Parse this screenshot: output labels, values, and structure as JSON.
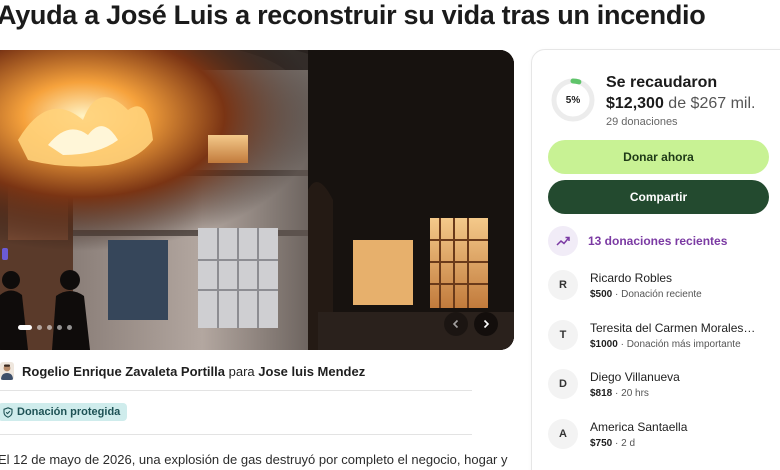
{
  "campaign": {
    "title": "Ayuda a José Luis a reconstruir su vida tras un incendio"
  },
  "gallery": {
    "slide_count": 5,
    "active_slide": 1,
    "prev_icon": "chevron-left-icon",
    "next_icon": "chevron-right-icon"
  },
  "organizer": {
    "name": "Rogelio Enrique Zavaleta Portilla",
    "connector": "para",
    "beneficiary": "Jose luis Mendez"
  },
  "badge": {
    "icon": "shield-icon",
    "label": "Donación protegida"
  },
  "story": {
    "excerpt": "El 12 de mayo de 2026, una explosión de gas destruyó por completo el negocio, hogar y"
  },
  "donation_card": {
    "progress_percent": 5,
    "progress_label": "5%",
    "raised_label": "Se recaudaron",
    "raised_amount": "$12,300",
    "goal_text": "de $267 mil.",
    "donation_count": "29 donaciones",
    "donate_label": "Donar ahora",
    "share_label": "Compartir",
    "recent_label": "13 donaciones recientes",
    "colors": {
      "progress": "#5fc46a",
      "donate_button": "#c8f294",
      "share_button": "#234a2f",
      "accent_purple": "#7b3aa3",
      "badge_bg": "#cfecec"
    },
    "donors": [
      {
        "initial": "R",
        "name": "Ricardo Robles",
        "amount": "$500",
        "note": "· Donación reciente"
      },
      {
        "initial": "T",
        "name": "Teresita del Carmen Morales…",
        "amount": "$1000",
        "note": "· Donación más importante"
      },
      {
        "initial": "D",
        "name": "Diego Villanueva",
        "amount": "$818",
        "note": "· 20 hrs"
      },
      {
        "initial": "A",
        "name": "America Santaella",
        "amount": "$750",
        "note": "· 2 d"
      }
    ]
  }
}
